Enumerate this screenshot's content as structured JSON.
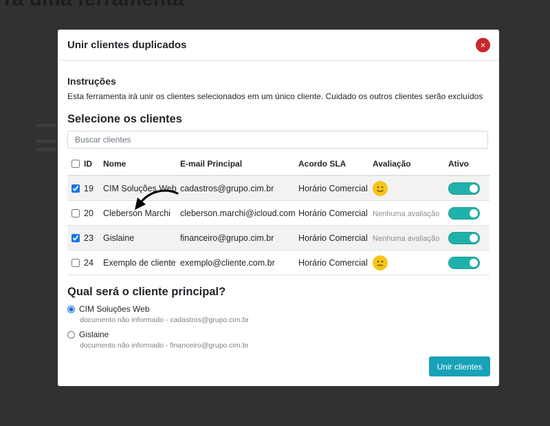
{
  "background": {
    "page_title": "ra uma ferramenta"
  },
  "modal": {
    "title": "Unir clientes duplicados",
    "close_icon": "×"
  },
  "instructions": {
    "title": "Instruções",
    "text": "Esta ferramenta irá unir os clientes selecionados em um único cliente. Cuidado os outros clientes serão excluídos"
  },
  "select_section": {
    "title": "Selecione os clientes",
    "search_placeholder": "Buscar clientes"
  },
  "table": {
    "headers": {
      "id": "ID",
      "name": "Nome",
      "email": "E-mail Principal",
      "sla": "Acordo SLA",
      "rating": "Avaliação",
      "active": "Ativo"
    },
    "rows": [
      {
        "checked": true,
        "id": "19",
        "name": "CIM Soluções Web",
        "email": "cadastros@grupo.cim.br",
        "sla": "Horário Comercial",
        "rating": "happy-face-icon",
        "rating_text": "",
        "active": true
      },
      {
        "checked": false,
        "id": "20",
        "name": "Cleberson Marchi",
        "email": "cleberson.marchi@icloud.com",
        "sla": "Horário Comercial",
        "rating": "",
        "rating_text": "Nenhuma avaliação",
        "active": true
      },
      {
        "checked": true,
        "id": "23",
        "name": "Gislaine",
        "email": "financeiro@grupo.cim.br",
        "sla": "Horário Comercial",
        "rating": "",
        "rating_text": "Nenhuma avaliação",
        "active": true
      },
      {
        "checked": false,
        "id": "24",
        "name": "Exemplo de cliente",
        "email": "exemplo@cliente.com.br",
        "sla": "Horário Comercial",
        "rating": "neutral-face-icon",
        "rating_text": "",
        "active": true
      }
    ]
  },
  "principal": {
    "title": "Qual será o cliente principal?",
    "options": [
      {
        "label": "CIM Soluções Web",
        "detail": "documento não informado - cadastros@grupo.cim.br",
        "selected": true
      },
      {
        "label": "Gislaine",
        "detail": "documento não informado - financeiro@grupo.cim.br",
        "selected": false
      }
    ]
  },
  "actions": {
    "merge_label": "Unir clientes"
  },
  "colors": {
    "accent": "#17a2b8",
    "toggle": "#20b2aa",
    "close": "#c8262d",
    "emoji": "#f7c518"
  }
}
